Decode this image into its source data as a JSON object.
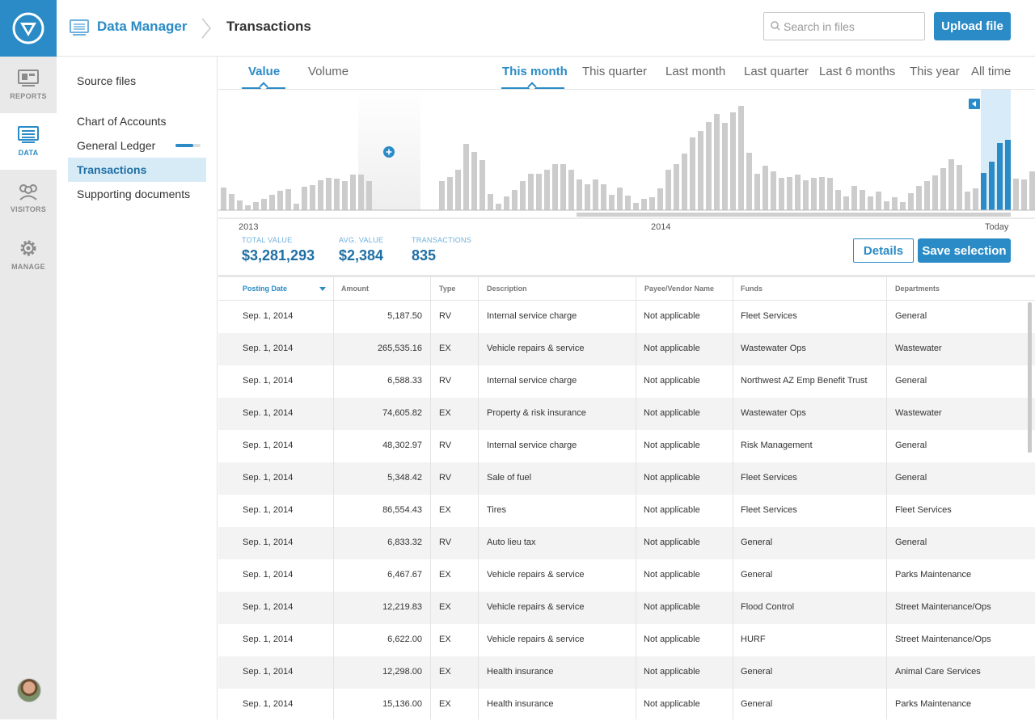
{
  "nav": {
    "items": [
      {
        "label": "REPORTS",
        "icon": "reports-icon"
      },
      {
        "label": "DATA",
        "icon": "data-icon",
        "active": true
      },
      {
        "label": "VISITORS",
        "icon": "visitors-icon"
      },
      {
        "label": "MANAGE",
        "icon": "gear-icon"
      }
    ]
  },
  "header": {
    "app_title": "Data Manager",
    "page_title": "Transactions",
    "search_placeholder": "Search in files",
    "upload_label": "Upload file"
  },
  "sidebar": {
    "items": [
      {
        "label": "Source files"
      },
      {
        "label": "Chart of Accounts"
      },
      {
        "label": "General Ledger",
        "progress": 0.7
      },
      {
        "label": "Transactions",
        "active": true
      },
      {
        "label": "Supporting documents"
      }
    ]
  },
  "metric_tabs": [
    "Value",
    "Volume"
  ],
  "period_tabs": [
    "This month",
    "This quarter",
    "Last month",
    "Last quarter",
    "Last 6 months",
    "This year",
    "All time"
  ],
  "chart_data": {
    "type": "bar",
    "x_axis_labels": [
      "2013",
      "2014",
      "Today"
    ],
    "colors": {
      "default": "#cccccc",
      "selected": "#2a8bc6",
      "selection_bg": "#d8ebf8"
    },
    "values": [
      28,
      20,
      12,
      6,
      10,
      14,
      19,
      24,
      26,
      8,
      29,
      31,
      37,
      40,
      39,
      36,
      44,
      44,
      36,
      0,
      0,
      0,
      0,
      0,
      0,
      0,
      0,
      36,
      41,
      50,
      82,
      72,
      62,
      20,
      8,
      17,
      25,
      36,
      45,
      45,
      50,
      57,
      57,
      50,
      38,
      32,
      38,
      32,
      19,
      28,
      18,
      9,
      14,
      16,
      27,
      50,
      57,
      70,
      90,
      98,
      109,
      119,
      108,
      121,
      129,
      71,
      45,
      55,
      48,
      40,
      41,
      44,
      37,
      40,
      41,
      40,
      25,
      17,
      30,
      25,
      17,
      23,
      11,
      16,
      10,
      21,
      30,
      36,
      43,
      52,
      63,
      56,
      23,
      27,
      28,
      25,
      39,
      29,
      39,
      38,
      48,
      63,
      67,
      59,
      80,
      80,
      24,
      25,
      32
    ],
    "selected_values": [
      46,
      60,
      83,
      87
    ]
  },
  "stats": [
    {
      "label": "TOTAL VALUE",
      "value": "$3,281,293"
    },
    {
      "label": "AVG. VALUE",
      "value": "$2,384"
    },
    {
      "label": "TRANSACTIONS",
      "value": "835"
    }
  ],
  "details_label": "Details",
  "save_label": "Save selection",
  "table": {
    "columns": [
      "Posting Date",
      "Amount",
      "Type",
      "Description",
      "Payee/Vendor Name",
      "Funds",
      "Departments"
    ],
    "rows": [
      [
        "Sep. 1, 2014",
        "5,187.50",
        "RV",
        "Internal service charge",
        "Not applicable",
        "Fleet Services",
        "General"
      ],
      [
        "Sep. 1, 2014",
        "265,535.16",
        "EX",
        "Vehicle repairs & service",
        "Not applicable",
        "Wastewater Ops",
        "Wastewater"
      ],
      [
        "Sep. 1, 2014",
        "6,588.33",
        "RV",
        "Internal service charge",
        "Not applicable",
        "Northwest AZ Emp Benefit Trust",
        "General"
      ],
      [
        "Sep. 1, 2014",
        "74,605.82",
        "EX",
        "Property & risk insurance",
        "Not applicable",
        "Wastewater Ops",
        "Wastewater"
      ],
      [
        "Sep. 1, 2014",
        "48,302.97",
        "RV",
        "Internal service charge",
        "Not applicable",
        "Risk Management",
        "General"
      ],
      [
        "Sep. 1, 2014",
        "5,348.42",
        "RV",
        "Sale of fuel",
        "Not applicable",
        "Fleet Services",
        "General"
      ],
      [
        "Sep. 1, 2014",
        "86,554.43",
        "EX",
        "Tires",
        "Not applicable",
        "Fleet Services",
        "Fleet Services"
      ],
      [
        "Sep. 1, 2014",
        "6,833.32",
        "RV",
        "Auto lieu tax",
        "Not applicable",
        "General",
        "General"
      ],
      [
        "Sep. 1, 2014",
        "6,467.67",
        "EX",
        "Vehicle repairs & service",
        "Not applicable",
        "General",
        "Parks Maintenance"
      ],
      [
        "Sep. 1, 2014",
        "12,219.83",
        "EX",
        "Vehicle repairs & service",
        "Not applicable",
        "Flood Control",
        "Street Maintenance/Ops"
      ],
      [
        "Sep. 1, 2014",
        "6,622.00",
        "EX",
        "Vehicle repairs & service",
        "Not applicable",
        "HURF",
        "Street Maintenance/Ops"
      ],
      [
        "Sep. 1, 2014",
        "12,298.00",
        "EX",
        "Health insurance",
        "Not applicable",
        "General",
        "Animal Care Services"
      ],
      [
        "Sep. 1, 2014",
        "15,136.00",
        "EX",
        "Health insurance",
        "Not applicable",
        "General",
        "Parks Maintenance"
      ]
    ]
  }
}
